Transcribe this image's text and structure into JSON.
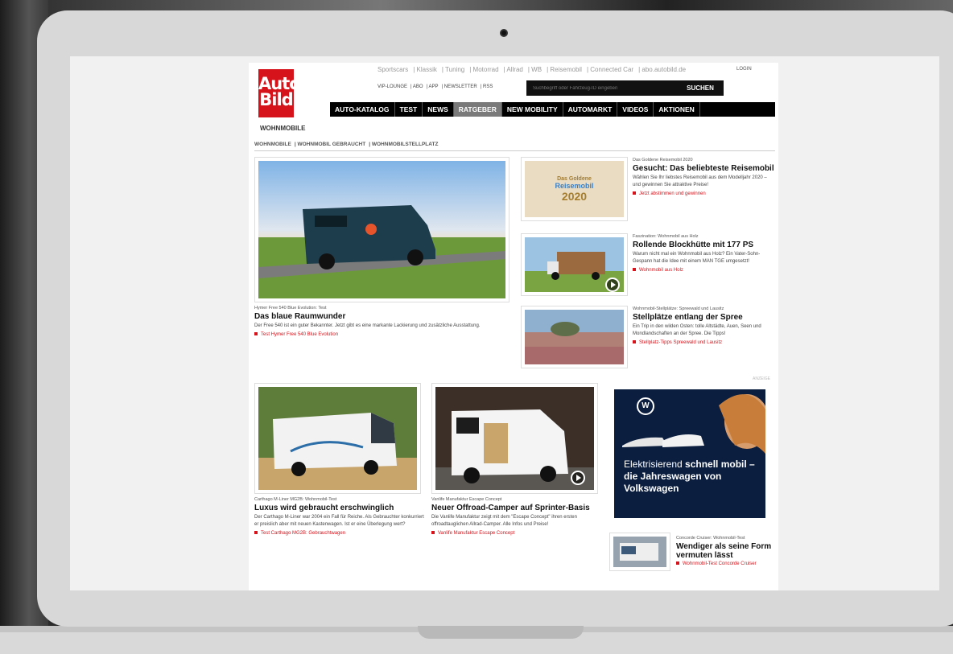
{
  "site": {
    "logo_line1": "Auto",
    "logo_line2": "Bild",
    "brands": [
      "Sportscars",
      "Klassik",
      "Tuning",
      "Motorrad",
      "Allrad",
      "WB",
      "Reisemobil",
      "Connected Car",
      "abo.autobild.de"
    ],
    "login": "LOGIN",
    "utility": [
      "VIP-LOUNGE",
      "ABO",
      "APP",
      "NEWSLETTER",
      "RSS"
    ],
    "search_placeholder": "Suchbegriff oder Fahrzeug-ID eingeben",
    "search_button": "SUCHEN",
    "nav": [
      {
        "label": "AUTO-KATALOG",
        "active": false
      },
      {
        "label": "TEST",
        "active": false
      },
      {
        "label": "NEWS",
        "active": false
      },
      {
        "label": "RATGEBER",
        "active": true
      },
      {
        "label": "NEW MOBILITY",
        "active": false
      },
      {
        "label": "AUTOMARKT",
        "active": false
      },
      {
        "label": "VIDEOS",
        "active": false
      },
      {
        "label": "AKTIONEN",
        "active": false
      }
    ],
    "section_title": "WOHNMOBILE",
    "subnav": [
      "WOHNMOBILE",
      "WOHNMOBIL GEBRAUCHT",
      "WOHNMOBILSTELLPLATZ"
    ]
  },
  "lead": {
    "kicker": "Hymer Free 540 Blue Evolution: Test",
    "headline": "Das blaue Raumwunder",
    "teaser": "Der Free 540 ist ein guter Bekannter. Jetzt gibt es eine markante Lackierung und zusätzliche Ausstattung.",
    "link": "Test Hymer Free 540 Blue Evolution"
  },
  "side": [
    {
      "kicker": "Das Goldene Reisemobil 2020",
      "headline": "Gesucht: Das beliebteste Reisemobil",
      "teaser": "Wählen Sie Ihr liebstes Reisemobil aus dem Modelljahr 2020 – und gewinnen Sie attraktive Preise!",
      "link": "Jetzt abstimmen und gewinnen",
      "award_line1": "Das Goldene",
      "award_line2": "Reisemobil",
      "award_line3": "2020"
    },
    {
      "kicker": "Faszination: Wohnmobil aus Holz",
      "headline": "Rollende Blockhütte mit 177 PS",
      "teaser": "Warum nicht mal ein Wohnmobil aus Holz? Ein Vater-Sohn-Gespann hat die Idee mit einem MAN TGE umgesetzt!",
      "link": "Wohnmobil aus Holz"
    },
    {
      "kicker": "Wohnmobil-Stellplätze: Spreewald und Lausitz",
      "headline": "Stellplätze entlang der Spree",
      "teaser": "Ein Trip in den wilden Osten: tolle Altstädte, Auen, Seen und Mondlandschaften an der Spree. Die Tipps!",
      "link": "Stellplatz-Tipps Spreewald und Lausitz"
    }
  ],
  "bottom": [
    {
      "kicker": "Carthago M-Liner MG2B: Wohnmobil-Test",
      "headline": "Luxus wird gebraucht erschwinglich",
      "teaser": "Der Carthago M-Liner war 2004 ein Fall für Reiche. Als Gebrauchter konkurriert er preislich aber mit neuen Kastenwagen. Ist er eine Überlegung wert?",
      "link": "Test Carthago MG2B: Gebrauchtwagen"
    },
    {
      "kicker": "Vanlife Manufaktur Escape Concept",
      "headline": "Neuer Offroad-Camper auf Sprinter-Basis",
      "teaser": "Die Vanlife Manufaktur zeigt mit dem \"Escape Concept\" ihren ersten offroadtauglichen Allrad-Camper. Alle Infos und Preise!",
      "link": "Vanlife Manufaktur Escape Concept"
    }
  ],
  "ad": {
    "label": "ANZEIGE",
    "logo": "W",
    "text_light": "Elektrisierend ",
    "text_bold1": "schnell mobil –",
    "text_bold2": "die Jahreswagen von Volkswagen"
  },
  "small": {
    "kicker": "Concorde Cruiser: Wohnmobil-Test",
    "headline": "Wendiger als seine Form vermuten lässt",
    "link": "Wohnmobil-Test Concorde Cruiser"
  },
  "colors": {
    "brand_red": "#d6131b",
    "nav_bg": "#000000",
    "nav_active": "#7a7a7a"
  }
}
